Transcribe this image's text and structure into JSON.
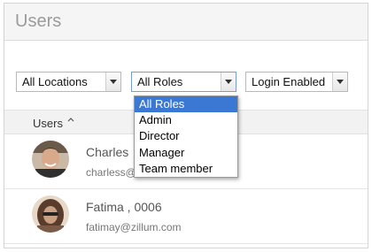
{
  "header": {
    "title": "Users"
  },
  "filters": {
    "locations": {
      "selected": "All Locations"
    },
    "roles": {
      "selected": "All Roles",
      "options": [
        "All Roles",
        "Admin",
        "Director",
        "Manager",
        "Team member"
      ],
      "highlighted_index": 0
    },
    "login": {
      "selected": "Login Enabled"
    }
  },
  "table": {
    "column_label": "Users",
    "sort_icon": "sort-updown-icon",
    "rows": [
      {
        "name": "Charles",
        "email": "charless@",
        "avatar_icon": "user-avatar-icon"
      },
      {
        "name": "Fatima ,  0006",
        "email": "fatimay@zillum.com",
        "avatar_icon": "user-avatar-icon"
      }
    ]
  },
  "colors": {
    "accent": "#3a78d4",
    "header_bg": "#f5f5f5",
    "title_text": "#9b9b9b"
  }
}
